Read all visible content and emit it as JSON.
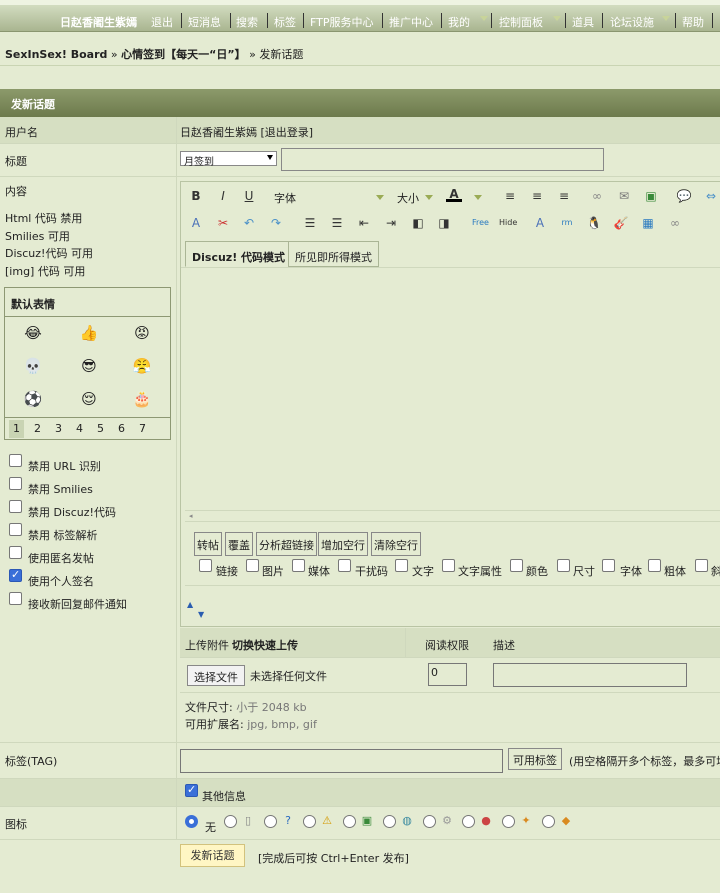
{
  "nav": {
    "username": "日赵香阇生紫嫣",
    "items": [
      "退出",
      "短消息",
      "搜索",
      "标签",
      "FTP服务中心",
      "推广中心",
      "我的",
      "控制面板",
      "道具",
      "论坛设施",
      "帮助"
    ]
  },
  "breadcrumb": {
    "board": "SexInSex! Board",
    "sep1": "»",
    "forum": "心情签到【每天一“日”】",
    "sep2": "»",
    "page": "发新话题"
  },
  "form": {
    "title": "发新话题",
    "username_label": "用户名",
    "username_value": "日赵香阇生紫嫣 [退出登录]",
    "subject_label": "标题",
    "subject_type": "月签到",
    "content_label": "内容",
    "code_status": [
      {
        "name": "Html 代码",
        "status": "禁用"
      },
      {
        "name": "Smilies",
        "status": "可用"
      },
      {
        "name": "Discuz!代码",
        "status": "可用"
      },
      {
        "name": "[img] 代码",
        "status": "可用"
      }
    ],
    "smilies_title": "默认表情",
    "smilies_pages": [
      "1",
      "2",
      "3",
      "4",
      "5",
      "6",
      "7"
    ],
    "options": [
      {
        "label": "禁用 URL 识别",
        "checked": false
      },
      {
        "label": "禁用 Smilies",
        "checked": false
      },
      {
        "label": "禁用 Discuz!代码",
        "checked": false
      },
      {
        "label": "禁用 标签解析",
        "checked": false
      },
      {
        "label": "使用匿名发帖",
        "checked": false
      },
      {
        "label": "使用个人签名",
        "checked": true
      },
      {
        "label": "接收新回复邮件通知",
        "checked": false
      }
    ]
  },
  "editor": {
    "font_label": "字体",
    "size_label": "大小",
    "tab_discuz": "Discuz! 代码模式",
    "tab_wysiwyg": "所见即所得模式",
    "action_buttons": [
      "转帖",
      "覆盖",
      "分析超链接",
      "增加空行",
      "清除空行"
    ],
    "filters": [
      "链接",
      "图片",
      "媒体",
      "干扰码",
      "文字",
      "文字属性",
      "颜色",
      "尺寸",
      "字体",
      "粗体",
      "斜"
    ]
  },
  "attachments": {
    "header_label": "上传附件",
    "header_quick": "切换快速上传",
    "perm_label": "阅读权限",
    "desc_label": "描述",
    "choose_button": "选择文件",
    "no_file": "未选择任何文件",
    "perm_value": "0",
    "size_label": "文件尺寸:",
    "size_value": "小于 2048 kb",
    "ext_label": "可用扩展名:",
    "ext_value": "jpg, bmp, gif"
  },
  "tags": {
    "label": "标签(TAG)",
    "button": "可用标签",
    "hint": "(用空格隔开多个标签，最多可填"
  },
  "other": {
    "label": "其他信息",
    "checked": true
  },
  "icons": {
    "label": "图标",
    "none_label": "无"
  },
  "submit": {
    "button": "发新话题",
    "hint": "[完成后可按 Ctrl+Enter 发布]"
  }
}
